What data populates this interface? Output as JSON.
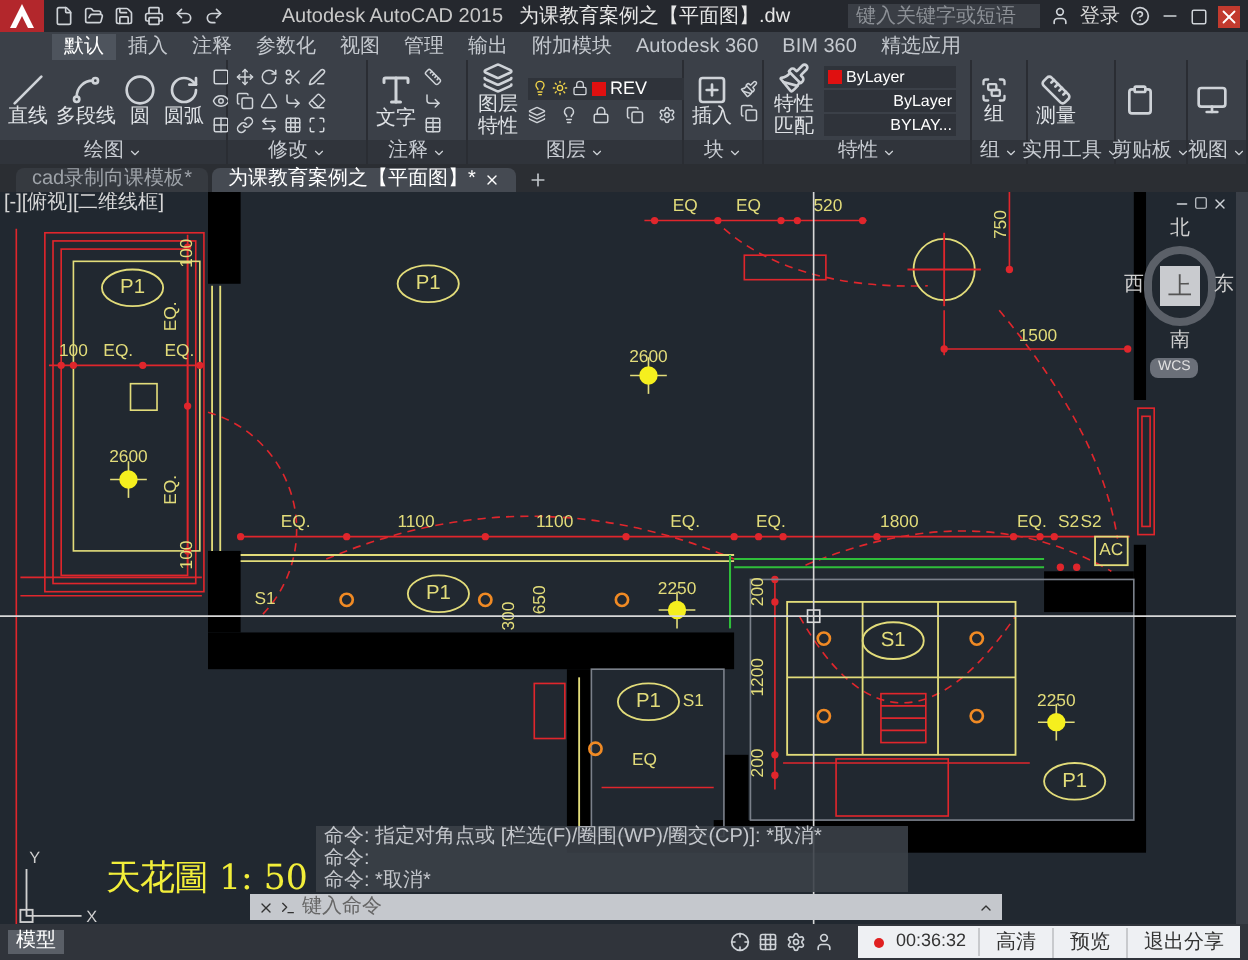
{
  "title_bar": {
    "app_title": "Autodesk AutoCAD 2015",
    "document_title": "为课教育案例之【平面图】.dw",
    "search_placeholder": "键入关键字或短语",
    "login": "登录"
  },
  "ribbon_tabs": [
    {
      "label": "默认",
      "selected": true
    },
    {
      "label": "插入",
      "selected": false
    },
    {
      "label": "注释",
      "selected": false
    },
    {
      "label": "参数化",
      "selected": false
    },
    {
      "label": "视图",
      "selected": false
    },
    {
      "label": "管理",
      "selected": false
    },
    {
      "label": "输出",
      "selected": false
    },
    {
      "label": "附加模块",
      "selected": false
    },
    {
      "label": "Autodesk 360",
      "selected": false
    },
    {
      "label": "BIM 360",
      "selected": false
    },
    {
      "label": "精选应用",
      "selected": false
    }
  ],
  "ribbon": {
    "draw": {
      "title": "绘图",
      "tools": [
        "直线",
        "多段线",
        "圆",
        "圆弧"
      ]
    },
    "modify": {
      "title": "修改"
    },
    "annotation": {
      "title": "注释",
      "tool": "文字"
    },
    "layers": {
      "title": "图层",
      "tool": "图层特性",
      "current_layer": "REV"
    },
    "block": {
      "title": "块",
      "tool": "插入"
    },
    "properties": {
      "title": "特性",
      "tool": "特性匹配",
      "color_setting": "ByLayer",
      "linetype": "ByLayer",
      "lineweight": "BYLAY..."
    },
    "groups": {
      "title": "组",
      "tool": "组"
    },
    "utilities": {
      "title": "实用工具",
      "tool": "测量"
    },
    "clipboard": {
      "title": "剪贴板"
    },
    "view": {
      "title": "视图"
    }
  },
  "document_tabs": [
    {
      "label": "cad录制向课模板*",
      "selected": false
    },
    {
      "label": "为课教育案例之【平面图】*",
      "selected": true
    }
  ],
  "viewport_label": "[-][俯视][二维线框]",
  "drawing": {
    "labels": [
      {
        "text": "P1",
        "kind": "tag"
      },
      {
        "text": "P1",
        "kind": "tag"
      },
      {
        "text": "P1",
        "kind": "tag"
      },
      {
        "text": "P1",
        "kind": "tag"
      },
      {
        "text": "P1",
        "kind": "tag"
      },
      {
        "text": "S1",
        "kind": "tag"
      },
      {
        "text": "100",
        "kind": "dim"
      },
      {
        "text": "EQ.",
        "kind": "dim"
      },
      {
        "text": "EQ.",
        "kind": "dim"
      },
      {
        "text": "EQ.",
        "kind": "vdim"
      },
      {
        "text": "EQ.",
        "kind": "vdim"
      },
      {
        "text": "100",
        "kind": "vdim"
      },
      {
        "text": "100",
        "kind": "vdim"
      },
      {
        "text": "2600",
        "kind": "dim"
      },
      {
        "text": "2600",
        "kind": "dim"
      },
      {
        "text": "EQ",
        "kind": "dim"
      },
      {
        "text": "EQ",
        "kind": "dim"
      },
      {
        "text": "520",
        "kind": "dim"
      },
      {
        "text": "750",
        "kind": "vdim"
      },
      {
        "text": "1500",
        "kind": "dim"
      },
      {
        "text": "EQ.",
        "kind": "dim"
      },
      {
        "text": "1100",
        "kind": "dim"
      },
      {
        "text": "1100",
        "kind": "dim"
      },
      {
        "text": "EQ.",
        "kind": "dim"
      },
      {
        "text": "EQ.",
        "kind": "dim"
      },
      {
        "text": "1800",
        "kind": "dim"
      },
      {
        "text": "EQ.",
        "kind": "dim"
      },
      {
        "text": "S2",
        "kind": "dim"
      },
      {
        "text": "S2",
        "kind": "dim"
      },
      {
        "text": "AC",
        "kind": "boxed"
      },
      {
        "text": "S1",
        "kind": "dim"
      },
      {
        "text": "2250",
        "kind": "dim"
      },
      {
        "text": "300",
        "kind": "vdim"
      },
      {
        "text": "650",
        "kind": "vdim"
      },
      {
        "text": "S1",
        "kind": "dim"
      },
      {
        "text": "2250",
        "kind": "dim"
      },
      {
        "text": "200",
        "kind": "vdim"
      },
      {
        "text": "1200",
        "kind": "vdim"
      },
      {
        "text": "200",
        "kind": "vdim"
      },
      {
        "text": "EQ",
        "kind": "dim"
      }
    ],
    "title": "天花圖 1: 50"
  },
  "view_cube": {
    "north": "北",
    "south": "南",
    "east": "东",
    "west": "西",
    "face": "上",
    "ucs": "WCS"
  },
  "ucs_icon": {
    "x_label": "X",
    "y_label": "Y"
  },
  "command_history": [
    "命令: 指定对角点或 [栏选(F)/圈围(WP)/圈交(CP)]: *取消*",
    "命令:",
    "命令: *取消*"
  ],
  "command_placeholder": "键入命令",
  "status_bar": {
    "layout_tab": "模型"
  },
  "recording": {
    "time": "00:36:32",
    "buttons": [
      "高清",
      "预览",
      "退出分享"
    ]
  }
}
